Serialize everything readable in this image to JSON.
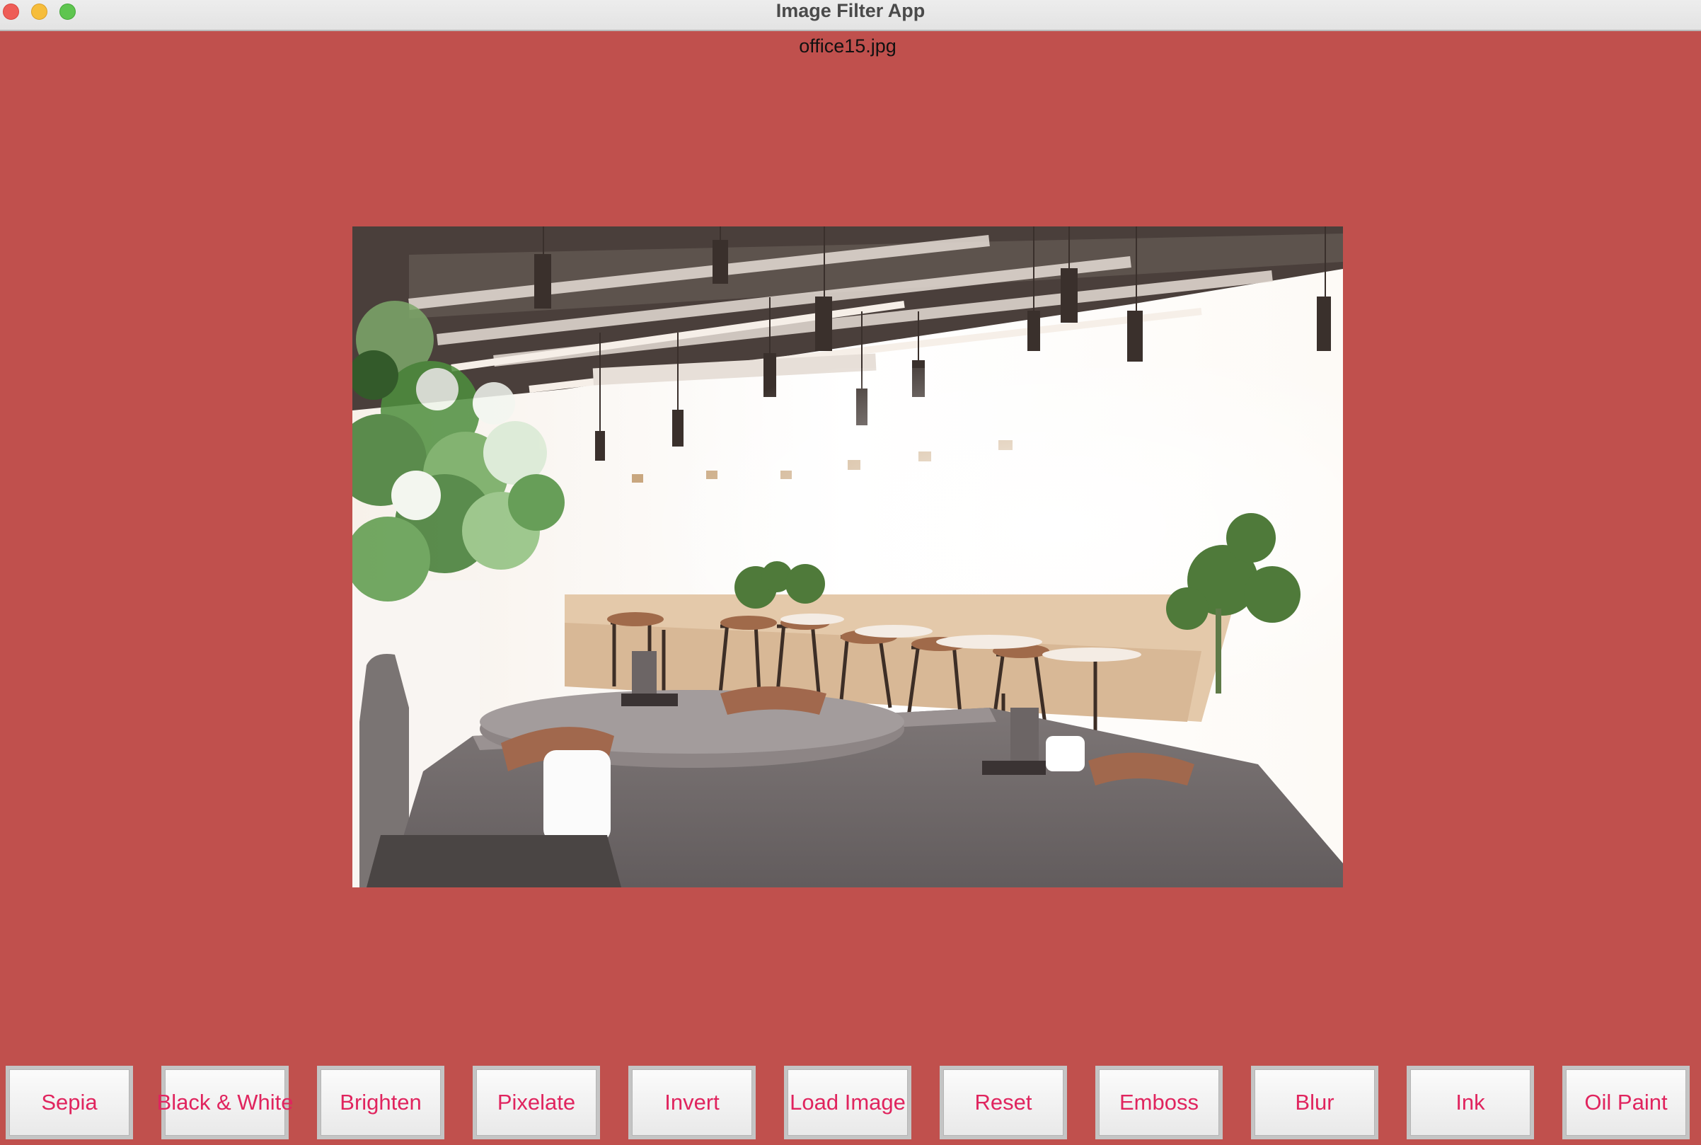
{
  "window": {
    "title": "Image Filter App",
    "background_color": "#c0504d",
    "controls": [
      "close-icon",
      "minimize-icon",
      "maximize-icon"
    ]
  },
  "image": {
    "filename": "office15.jpg"
  },
  "toolbar": {
    "button_text_color": "#e0245e",
    "buttons": [
      {
        "label": "Sepia"
      },
      {
        "label": "Black & White"
      },
      {
        "label": "Brighten"
      },
      {
        "label": "Pixelate"
      },
      {
        "label": "Invert"
      },
      {
        "label": "Load Image"
      },
      {
        "label": "Reset"
      },
      {
        "label": "Emboss"
      },
      {
        "label": "Blur"
      },
      {
        "label": "Ink"
      },
      {
        "label": "Oil Paint"
      }
    ]
  }
}
